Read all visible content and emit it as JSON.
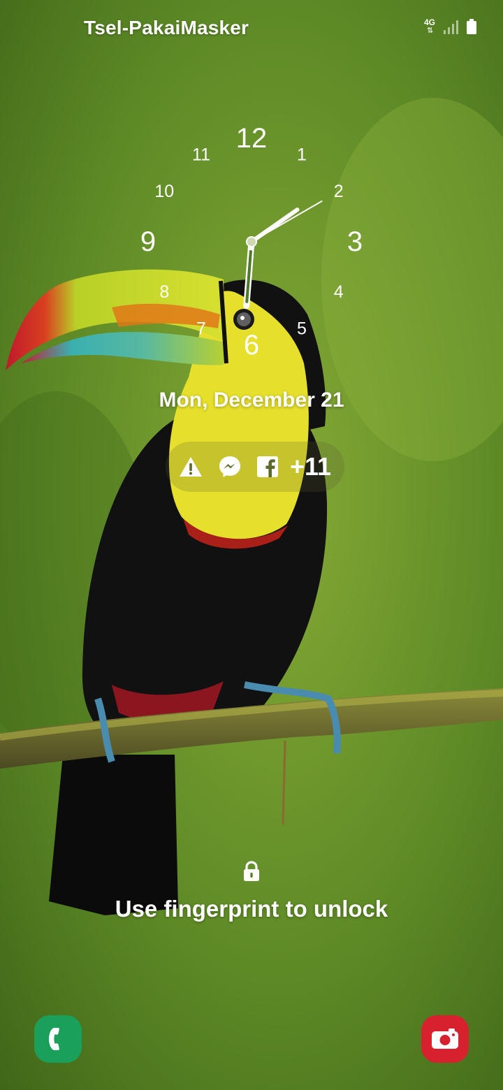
{
  "status_bar": {
    "carrier": "Tsel-PakaiMasker",
    "network_type": "4G",
    "signal_icon": "signal-icon",
    "battery_icon": "battery-icon"
  },
  "clock": {
    "numerals": [
      "12",
      "1",
      "2",
      "3",
      "4",
      "5",
      "6",
      "7",
      "8",
      "9",
      "10",
      "11"
    ],
    "hour": 6,
    "minute": 9,
    "second": 10
  },
  "lock_screen": {
    "date": "Mon, December 21",
    "notification_icons": [
      "warning-icon",
      "messenger-icon",
      "facebook-icon"
    ],
    "more_notifications": "+11",
    "lock_icon": "lock-icon",
    "unlock_hint": "Use fingerprint to unlock"
  },
  "shortcuts": {
    "left": "phone-icon",
    "right": "camera-icon"
  },
  "colors": {
    "phone_shortcut": "#1aa05a",
    "camera_shortcut": "#d8212f",
    "background": "#5f8a2a",
    "toucan_beak_yellow": "#d8e030",
    "toucan_chest": "#e8e030"
  }
}
